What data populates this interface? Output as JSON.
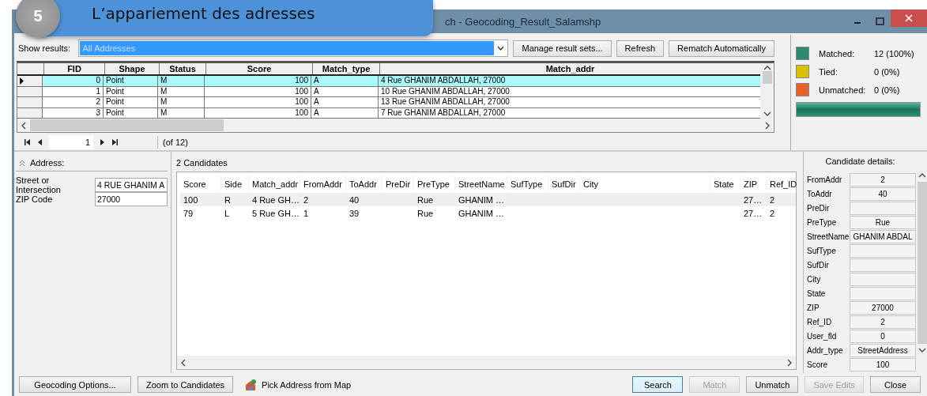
{
  "banner": {
    "number": "5",
    "title": "L’appariement des adresses"
  },
  "window": {
    "title": "ch - Geocoding_Result_Salamshp"
  },
  "toolbar": {
    "label": "Show results:",
    "combo_value": "All Addresses",
    "buttons": [
      "Manage result sets...",
      "Refresh",
      "Rematch Automatically"
    ]
  },
  "results_table": {
    "columns": [
      "FID",
      "Shape",
      "Status",
      "Score",
      "Match_type",
      "Match_addr"
    ],
    "rows": [
      {
        "selected": true,
        "cells": [
          "0",
          "Point",
          "M",
          "100",
          "A",
          "4 Rue GHANIM ABDALLAH, 27000"
        ]
      },
      {
        "selected": false,
        "cells": [
          "1",
          "Point",
          "M",
          "100",
          "A",
          "10 Rue GHANIM ABDALLAH, 27000"
        ]
      },
      {
        "selected": false,
        "cells": [
          "2",
          "Point",
          "M",
          "100",
          "A",
          "13 Rue GHANIM ABDALLAH, 27000"
        ]
      },
      {
        "selected": false,
        "cells": [
          "3",
          "Point",
          "M",
          "100",
          "A",
          "7 Rue GHANIM ABDALLAH, 27000"
        ]
      }
    ]
  },
  "navigator": {
    "record": "1",
    "total": "(of 12)"
  },
  "stats": {
    "items": [
      {
        "label": "Matched:",
        "value": "12 (100%)",
        "color": "#2a8a70"
      },
      {
        "label": "Tied:",
        "value": "0 (0%)",
        "color": "#d8c000"
      },
      {
        "label": "Unmatched:",
        "value": "0 (0%)",
        "color": "#e8602a"
      }
    ],
    "level": 1
  },
  "address": {
    "title": "Address:",
    "fields": [
      {
        "label": "Street or Intersection",
        "value": "4 RUE GHANIM A"
      },
      {
        "label": "ZIP Code",
        "value": "27000"
      }
    ]
  },
  "candidates": {
    "title": "2 Candidates",
    "columns": [
      "Score",
      "Side",
      "Match_addr",
      "FromAddr",
      "ToAddr",
      "PreDir",
      "PreType",
      "StreetName",
      "SufType",
      "SufDir",
      "City",
      "State",
      "ZIP",
      "Ref_ID"
    ],
    "rows": [
      {
        "selected": true,
        "cells": [
          "100",
          "R",
          "4 Rue GH…",
          "2",
          "40",
          "",
          "Rue",
          "GHANIM …",
          "",
          "",
          "",
          "",
          "27…",
          "2"
        ]
      },
      {
        "selected": false,
        "cells": [
          "79",
          "L",
          "5 Rue GH…",
          "1",
          "39",
          "",
          "Rue",
          "GHANIM …",
          "",
          "",
          "",
          "",
          "27…",
          "2"
        ]
      }
    ]
  },
  "details": {
    "title": "Candidate details:",
    "fields": [
      {
        "label": "FromAddr",
        "value": "2"
      },
      {
        "label": "ToAddr",
        "value": "40"
      },
      {
        "label": "PreDir"
      },
      {
        "label": "PreType",
        "value": "Rue"
      },
      {
        "label": "StreetName",
        "value": "GHANIM ABDAL"
      },
      {
        "label": "SufType"
      },
      {
        "label": "SufDir"
      },
      {
        "label": "City"
      },
      {
        "label": "State"
      },
      {
        "label": "ZIP",
        "value": "27000"
      },
      {
        "label": "Ref_ID",
        "value": "2"
      },
      {
        "label": "User_fld",
        "value": "0"
      },
      {
        "label": "Addr_type",
        "value": "StreetAddress"
      },
      {
        "label": "Score",
        "value": "100"
      }
    ]
  },
  "footer": {
    "left_buttons": [
      "Geocoding Options...",
      "Zoom to Candidates"
    ],
    "pick_button": "Pick Address from Map",
    "right_buttons": [
      {
        "label": "Search",
        "disabled": false,
        "default": true
      },
      {
        "label": "Match",
        "disabled": true,
        "default": false
      },
      {
        "label": "Unmatch",
        "disabled": false,
        "default": false
      },
      {
        "label": "Save Edits",
        "disabled": true,
        "default": false
      },
      {
        "label": "Close",
        "disabled": false,
        "default": false
      }
    ]
  }
}
